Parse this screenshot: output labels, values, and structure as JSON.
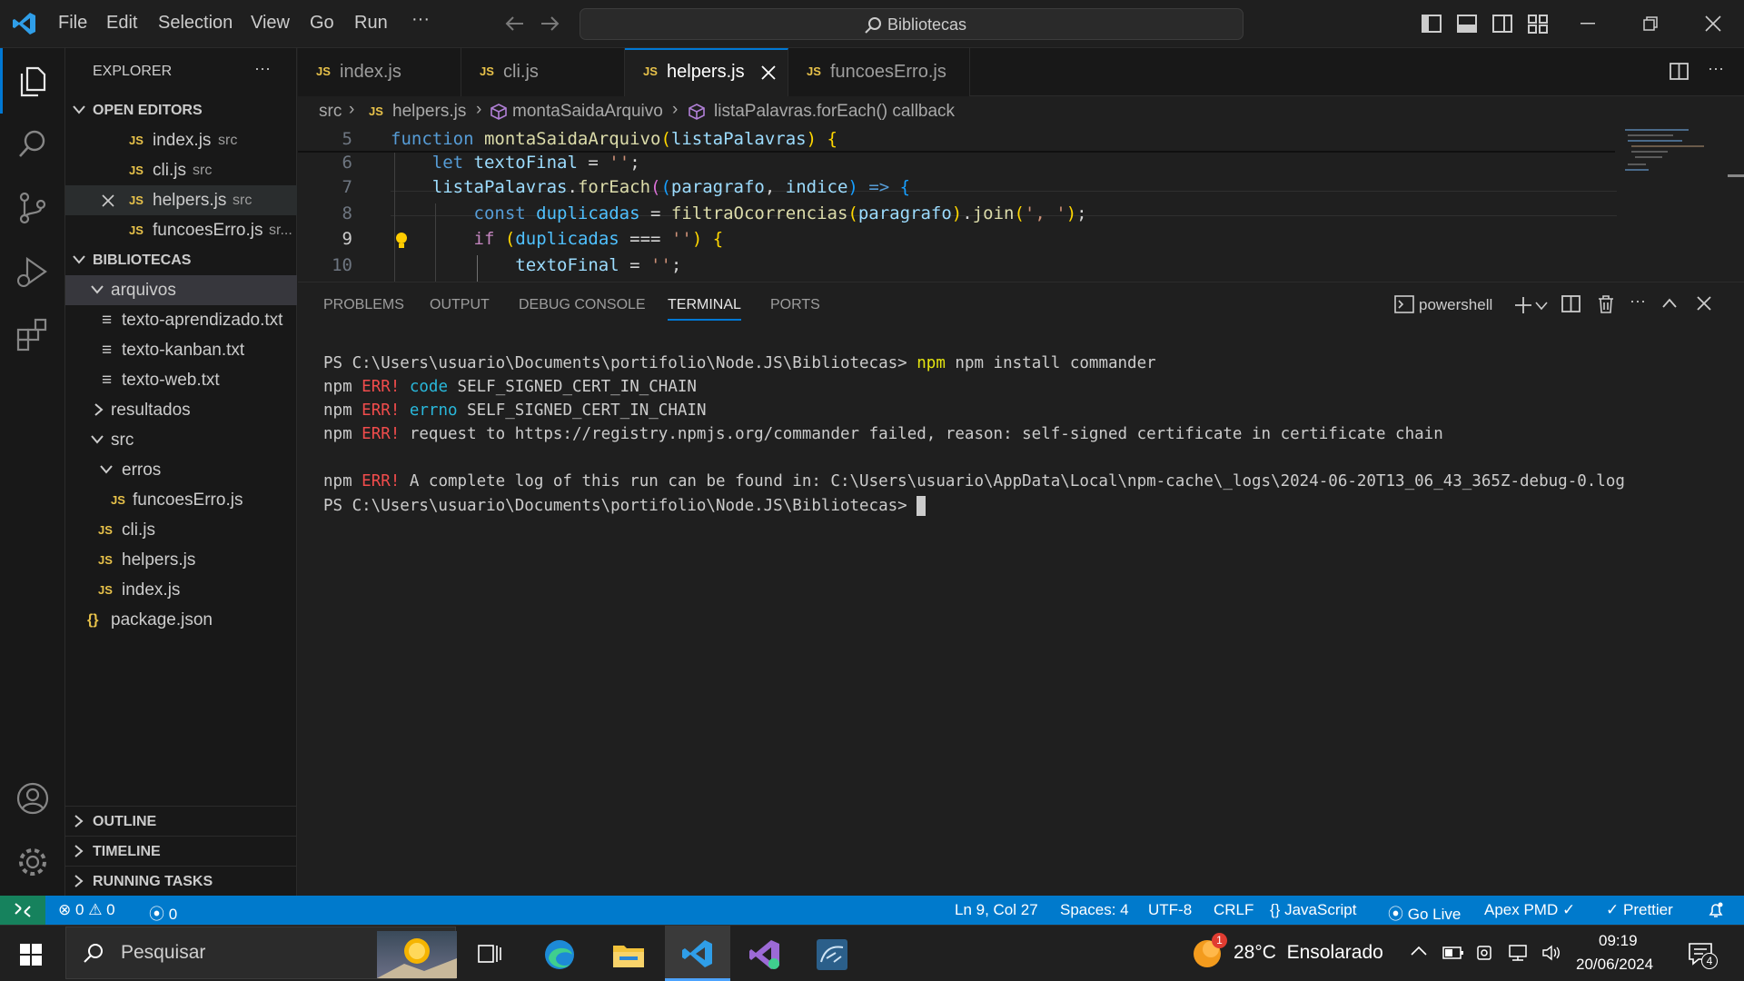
{
  "window": {
    "title": "Bibliotecas"
  },
  "menu": [
    "File",
    "Edit",
    "Selection",
    "View",
    "Go",
    "Run",
    "···"
  ],
  "explorer": {
    "header": "EXPLORER",
    "more": "···",
    "open_editors": {
      "title": "OPEN EDITORS",
      "items": [
        {
          "name": "index.js",
          "path": "src"
        },
        {
          "name": "cli.js",
          "path": "src"
        },
        {
          "name": "helpers.js",
          "path": "src"
        },
        {
          "name": "funcoesErro.js",
          "path": "sr..."
        }
      ]
    },
    "project": {
      "title": "BIBLIOTECAS",
      "folders": {
        "arquivos": "arquivos",
        "txt1": "texto-aprendizado.txt",
        "txt2": "texto-kanban.txt",
        "txt3": "texto-web.txt",
        "resultados": "resultados",
        "src": "src",
        "erros": "erros",
        "funcoes": "funcoesErro.js",
        "cli": "cli.js",
        "helpers": "helpers.js",
        "index": "index.js",
        "package": "package.json"
      }
    },
    "outline": "OUTLINE",
    "timeline": "TIMELINE",
    "running": "RUNNING TASKS"
  },
  "tabs": [
    {
      "label": "index.js"
    },
    {
      "label": "cli.js"
    },
    {
      "label": "helpers.js"
    },
    {
      "label": "funcoesErro.js"
    }
  ],
  "js_badge": "JS",
  "breadcrumb": {
    "src": "src",
    "file": "helpers.js",
    "fn": "montaSaidaArquivo",
    "cb": "listaPalavras.forEach() callback"
  },
  "editor": {
    "line_numbers": [
      "5",
      "6",
      "7",
      "8",
      "9",
      "10"
    ]
  },
  "panel": {
    "tabs": [
      "PROBLEMS",
      "OUTPUT",
      "DEBUG CONSOLE",
      "TERMINAL",
      "PORTS"
    ],
    "shell": "powershell",
    "terminal": {
      "prompt": "PS C:\\Users\\usuario\\Documents\\portifolio\\Node.JS\\Bibliotecas>",
      "command": "npm install commander",
      "npm": "npm",
      "err": "ERR!",
      "l2k": "code",
      "l2v": " SELF_SIGNED_CERT_IN_CHAIN",
      "l3k": "errno",
      "l3v": " SELF_SIGNED_CERT_IN_CHAIN",
      "l4": " request to https://registry.npmjs.org/commander failed, reason: self-signed certificate in certificate chain",
      "l5": " A complete log of this run can be found in: C:\\Users\\usuario\\AppData\\Local\\npm-cache\\_logs\\2024-06-20T13_06_43_365Z-debug-0.log"
    }
  },
  "status": {
    "errors": "0",
    "warnings": "0",
    "ports": "0",
    "position": "Ln 9, Col 27",
    "spaces": "Spaces: 4",
    "encoding": "UTF-8",
    "eol": "CRLF",
    "language": "JavaScript",
    "golive": "Go Live",
    "apex": "Apex PMD",
    "prettier": "Prettier"
  },
  "taskbar": {
    "search": "Pesquisar",
    "weather": "28°C  Ensolarado",
    "weather_badge": "1",
    "time": "09:19",
    "date": "20/06/2024",
    "notif": "4"
  },
  "colors": {
    "accent": "#0078d4",
    "statusbar": "#007acc",
    "error": "#f14c4c",
    "js": "#e8c24a"
  }
}
